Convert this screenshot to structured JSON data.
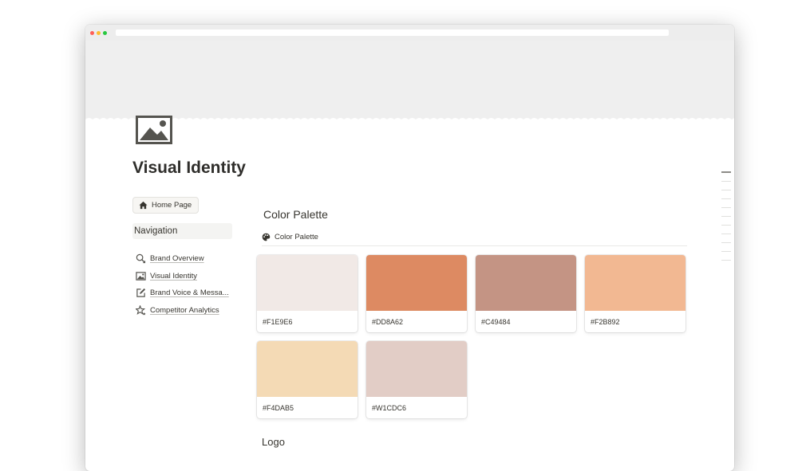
{
  "page": {
    "title": "Visual Identity"
  },
  "icons": {
    "page": "image-icon",
    "home": "home-icon",
    "palette": "palette-icon"
  },
  "sidebar": {
    "home_button": "Home Page",
    "nav_header": "Navigation",
    "items": [
      {
        "label": "Brand Overview",
        "icon": "search-icon"
      },
      {
        "label": "Visual Identity",
        "icon": "image-icon"
      },
      {
        "label": "Brand Voice & Messa...",
        "icon": "edit-icon"
      },
      {
        "label": "Competitor Analytics",
        "icon": "stars-icon"
      }
    ]
  },
  "main": {
    "section_title": "Color Palette",
    "database_title": "Color Palette",
    "colors": [
      {
        "label": "#F1E9E6",
        "swatch": "#f1e9e6"
      },
      {
        "label": "#DD8A62",
        "swatch": "#dd8a62"
      },
      {
        "label": "#C49484",
        "swatch": "#c49484"
      },
      {
        "label": "#F2B892",
        "swatch": "#f2b892"
      },
      {
        "label": "#F4DAB5",
        "swatch": "#f4dab5"
      },
      {
        "label": "#W1CDC6",
        "swatch": "#e2cdc6"
      }
    ],
    "next_section": "Logo"
  }
}
